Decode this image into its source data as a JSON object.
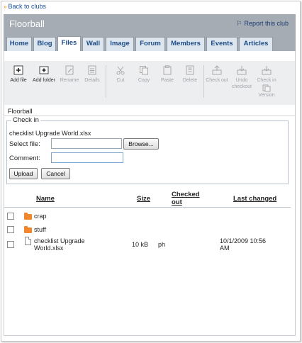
{
  "nav": {
    "back_label": "Back to clubs"
  },
  "header": {
    "title": "Floorball",
    "report_label": "Report this club"
  },
  "tabs": [
    {
      "label": "Home"
    },
    {
      "label": "Blog"
    },
    {
      "label": "Files",
      "active": true
    },
    {
      "label": "Wall"
    },
    {
      "label": "Image"
    },
    {
      "label": "Forum"
    },
    {
      "label": "Members"
    },
    {
      "label": "Events"
    },
    {
      "label": "Articles"
    }
  ],
  "toolbar": {
    "add_file": "Add file",
    "add_folder": "Add folder",
    "rename": "Rename",
    "details": "Details",
    "cut": "Cut",
    "copy": "Copy",
    "paste": "Paste",
    "delete": "Delete",
    "check_out": "Check out",
    "undo_checkout_1": "Undo",
    "undo_checkout_2": "checkout",
    "check_in_1": "Check in",
    "version": "Version"
  },
  "breadcrumb": {
    "current": "Floorball"
  },
  "checkin": {
    "legend": "Check in",
    "file_name": "checklist Upgrade World.xlsx",
    "select_label": "Select file:",
    "browse_label": "Browse...",
    "comment_label": "Comment:",
    "upload_label": "Upload",
    "cancel_label": "Cancel"
  },
  "table": {
    "columns": {
      "name": "Name",
      "size": "Size",
      "checked_out_1": "Checked",
      "checked_out_2": "out",
      "last_changed": "Last changed"
    },
    "rows": [
      {
        "type": "folder",
        "name": "crap",
        "size": "",
        "checked_out": "",
        "changed": ""
      },
      {
        "type": "folder",
        "name": "stuff",
        "size": "",
        "checked_out": "",
        "changed": ""
      },
      {
        "type": "file",
        "name_1": "checklist Upgrade",
        "name_2": "World.xlsx",
        "size": "10 kB",
        "checked_out": "ph",
        "changed_1": "10/1/2009 10:56",
        "changed_2": "AM"
      }
    ]
  },
  "colors": {
    "header_bg": "#a5acb3",
    "tab_bg": "#dde6ee",
    "link": "#1a4fa0",
    "folder": "#f0872c"
  }
}
